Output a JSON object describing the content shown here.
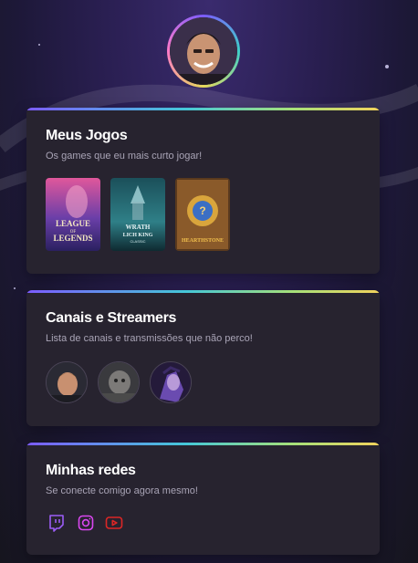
{
  "profile": {
    "avatar_icon": "avatar-photo"
  },
  "games_section": {
    "title": "Meus Jogos",
    "subtitle": "Os games que eu mais curto jogar!",
    "games": [
      {
        "name": "League of Legends",
        "art_line1": "LEAGUE",
        "art_line2": "LEGENDS",
        "art_of": "OF"
      },
      {
        "name": "World of Warcraft Wrath of the Lich King Classic",
        "art_line1": "WRATH",
        "art_line2": "LICH KING",
        "art_line3": "CLASSIC"
      },
      {
        "name": "Hearthstone",
        "art_line1": "HEARTHSTONE"
      }
    ]
  },
  "streamers_section": {
    "title": "Canais e Streamers",
    "subtitle": "Lista de canais e transmissões que não perco!"
  },
  "socials_section": {
    "title": "Minhas redes",
    "subtitle": "Se conecte comigo agora mesmo!",
    "links": [
      {
        "icon": "twitch-icon",
        "color": "#9b5cf6"
      },
      {
        "icon": "instagram-icon",
        "color": "#d946ef"
      },
      {
        "icon": "youtube-icon",
        "color": "#dc2626"
      }
    ]
  }
}
